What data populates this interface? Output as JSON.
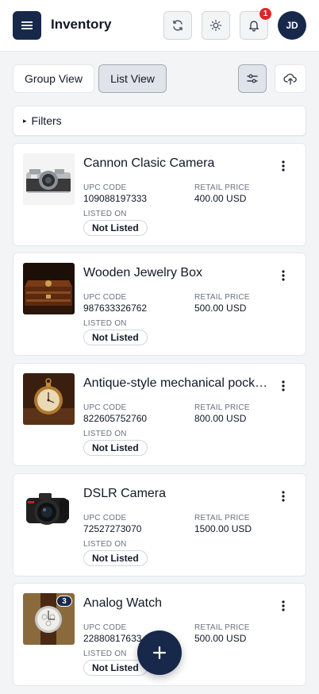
{
  "header": {
    "title": "Inventory",
    "menu_icon": "menu-icon",
    "refresh_icon": "refresh-icon",
    "theme_icon": "sun-icon",
    "bell_icon": "bell-icon",
    "notification_count": "1",
    "avatar_initials": "JD"
  },
  "toolbar": {
    "group_view_label": "Group View",
    "list_view_label": "List View",
    "selected_view": "List View",
    "filter_settings_icon": "sliders-icon",
    "upload_icon": "cloud-upload-icon"
  },
  "filters": {
    "label": "Filters",
    "caret": "▸"
  },
  "labels": {
    "upc": "UPC CODE",
    "price": "RETAIL PRICE",
    "listed": "LISTED ON"
  },
  "items": [
    {
      "name": "Cannon Clasic Camera",
      "upc": "109088197333",
      "price": "400.00 USD",
      "status": "Not Listed",
      "image_icon": "camera-photo"
    },
    {
      "name": "Wooden Jewelry Box",
      "upc": "987633326762",
      "price": "500.00 USD",
      "status": "Not Listed",
      "image_icon": "jewelry-box-photo"
    },
    {
      "name": "Antique-style mechanical pocket watch",
      "upc": "822605752760",
      "price": "800.00 USD",
      "status": "Not Listed",
      "image_icon": "pocket-watch-photo"
    },
    {
      "name": "DSLR Camera",
      "upc": "72527273070",
      "price": "1500.00 USD",
      "status": "Not Listed",
      "image_icon": "dslr-camera-photo"
    },
    {
      "name": "Analog Watch",
      "upc": "22880817633",
      "price": "500.00 USD",
      "status": "Not Listed",
      "image_icon": "wristwatch-photo",
      "image_count": "3"
    }
  ],
  "colors": {
    "primary": "#17284a",
    "badge_red": "#dc2626",
    "background": "#f3f4f6"
  },
  "fab": {
    "icon": "plus-icon"
  }
}
